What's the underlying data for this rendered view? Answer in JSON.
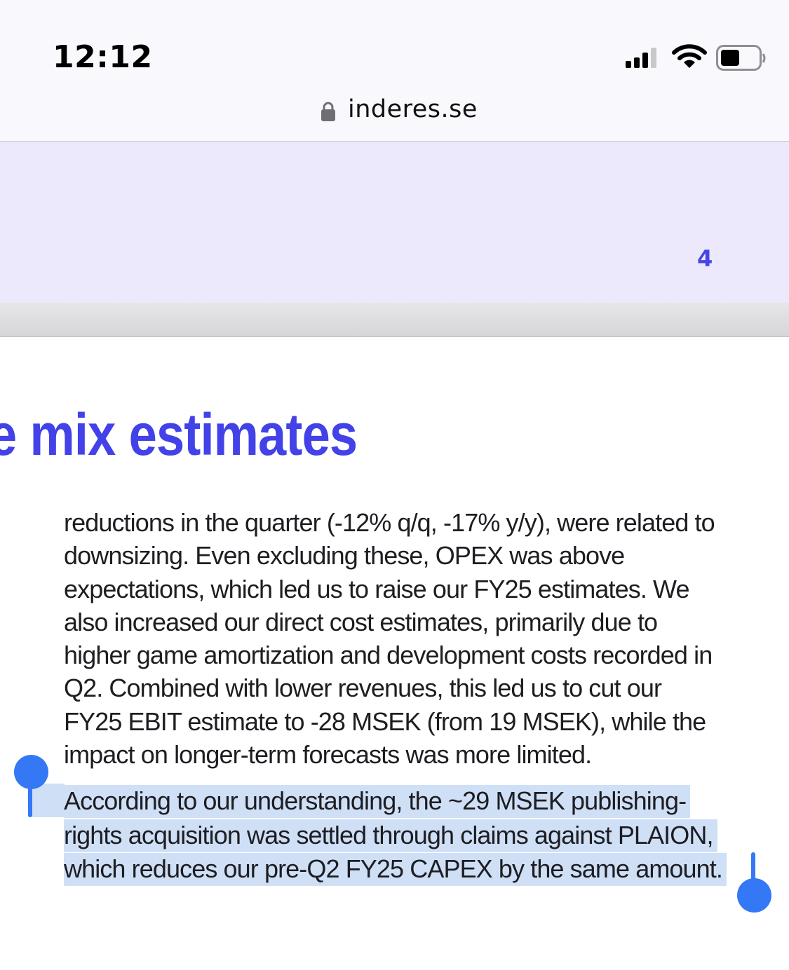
{
  "status_bar": {
    "time": "12:12",
    "icons": [
      "signal-icon",
      "wifi-icon",
      "battery-icon"
    ]
  },
  "address_bar": {
    "url": "inderes.se",
    "icon": "lock-icon"
  },
  "header": {
    "page_number": "4"
  },
  "article": {
    "heading": "e mix estimates",
    "paragraph_1": [
      "reductions in the quarter (-12% q/q, -17% y/y), were related to",
      "downsizing. Even excluding these, OPEX was above",
      "expectations, which led us to raise our FY25 estimates. We",
      "also increased our direct cost estimates, primarily due to",
      "higher game amortization and development costs recorded in",
      "Q2. Combined with lower revenues, this led us to cut our",
      "FY25 EBIT estimate to -28 MSEK (from 19 MSEK), while the",
      "impact on longer-term forecasts was more limited."
    ],
    "paragraph_2": [
      "According to our understanding, the ~29 MSEK publishing-",
      "rights acquisition was settled through claims against PLAION,",
      "which reduces our pre-Q2 FY25 CAPEX by the same amount."
    ]
  },
  "colors": {
    "heading": "#4242e8",
    "header_band": "#ebe9fb",
    "selection": "#cfe0f6",
    "selection_handle": "#3478f6"
  }
}
